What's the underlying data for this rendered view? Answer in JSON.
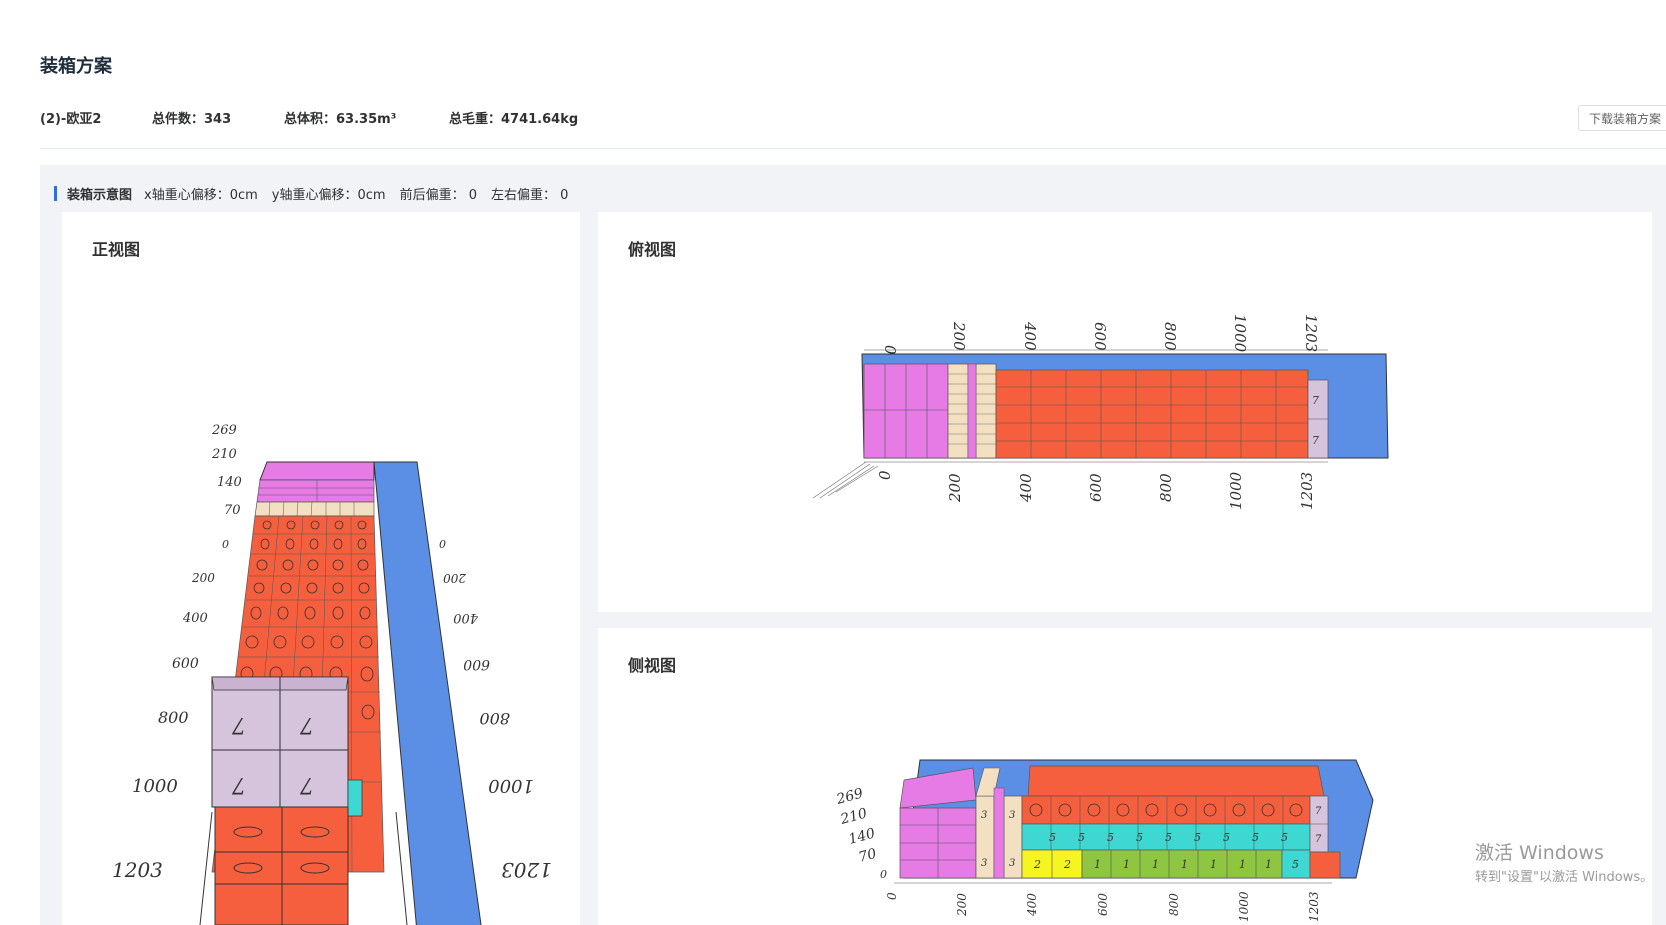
{
  "page": {
    "title": "装箱方案"
  },
  "summary": {
    "container": "(2)-欧亚2",
    "count": "总件数：343",
    "volume": "总体积：63.35m³",
    "weight": "总毛重：4741.64kg"
  },
  "actions": {
    "download": "下载装箱方案"
  },
  "panel": {
    "title": "装箱示意图",
    "x_offset": "x轴重心偏移：0cm",
    "y_offset": "y轴重心偏移：0cm",
    "front_back": "前后偏重：  0",
    "left_right": "左右偏重：  0"
  },
  "views": {
    "front": {
      "title": "正视图"
    },
    "top": {
      "title": "俯视图"
    },
    "side": {
      "title": "侧视图"
    }
  },
  "axis": {
    "length_ticks": [
      "0",
      "200",
      "400",
      "600",
      "800",
      "1000",
      "1203"
    ],
    "height_ticks": [
      "269",
      "210",
      "140",
      "70",
      "0"
    ]
  },
  "colors": {
    "accent": "#2f6fd6",
    "container_blue": "#5b8fe6",
    "item_1": "#8ec641",
    "item_2": "#f5f522",
    "item_3": "#f3dfc1",
    "item_4": "#e67be6",
    "item_5": "#3fd7d2",
    "item_6": "#f55f3d",
    "item_7": "#d6c3dc"
  },
  "watermark": {
    "line1": "激活 Windows",
    "line2": "转到\"设置\"以激活 Windows。"
  }
}
